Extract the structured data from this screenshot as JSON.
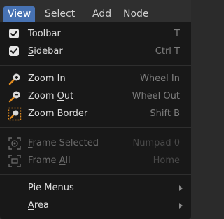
{
  "menubar": {
    "items": [
      {
        "label": "View",
        "active": true
      },
      {
        "label": "Select",
        "active": false
      },
      {
        "label": "Add",
        "active": false
      },
      {
        "label": "Node",
        "active": false
      }
    ]
  },
  "dropdown": {
    "toolbar": {
      "prefix": "",
      "underline": "T",
      "suffix": "oolbar",
      "shortcut": "T",
      "checked": true
    },
    "sidebar": {
      "prefix": "",
      "underline": "S",
      "suffix": "idebar",
      "shortcut": "Ctrl T",
      "checked": true
    },
    "zoom_in": {
      "prefix": "",
      "underline": "Z",
      "suffix": "oom In",
      "shortcut": "Wheel In",
      "icon": "zoom-in-icon"
    },
    "zoom_out": {
      "prefix": "Zoom ",
      "underline": "O",
      "suffix": "ut",
      "shortcut": "Wheel Out",
      "icon": "zoom-out-icon"
    },
    "zoom_border": {
      "prefix": "Zoom ",
      "underline": "B",
      "suffix": "order",
      "shortcut": "Shift B",
      "icon": "zoom-border-icon"
    },
    "frame_selected": {
      "prefix": "",
      "underline": "F",
      "suffix": "rame Selected",
      "shortcut": "Numpad 0",
      "icon": "frame-selected-icon",
      "disabled": true
    },
    "frame_all": {
      "prefix": "Frame ",
      "underline": "A",
      "suffix": "ll",
      "shortcut": "Home",
      "icon": "frame-all-icon",
      "disabled": true
    },
    "pie_menus": {
      "prefix": "",
      "underline": "P",
      "suffix": "ie Menus"
    },
    "area": {
      "prefix": "",
      "underline": "A",
      "suffix": "rea"
    }
  },
  "colors": {
    "accent": "#4772b3",
    "menu_bg": "#181818",
    "text": "#dcdcdc",
    "shortcut": "#7d7d7d",
    "icon_orange": "#e08a1e"
  }
}
